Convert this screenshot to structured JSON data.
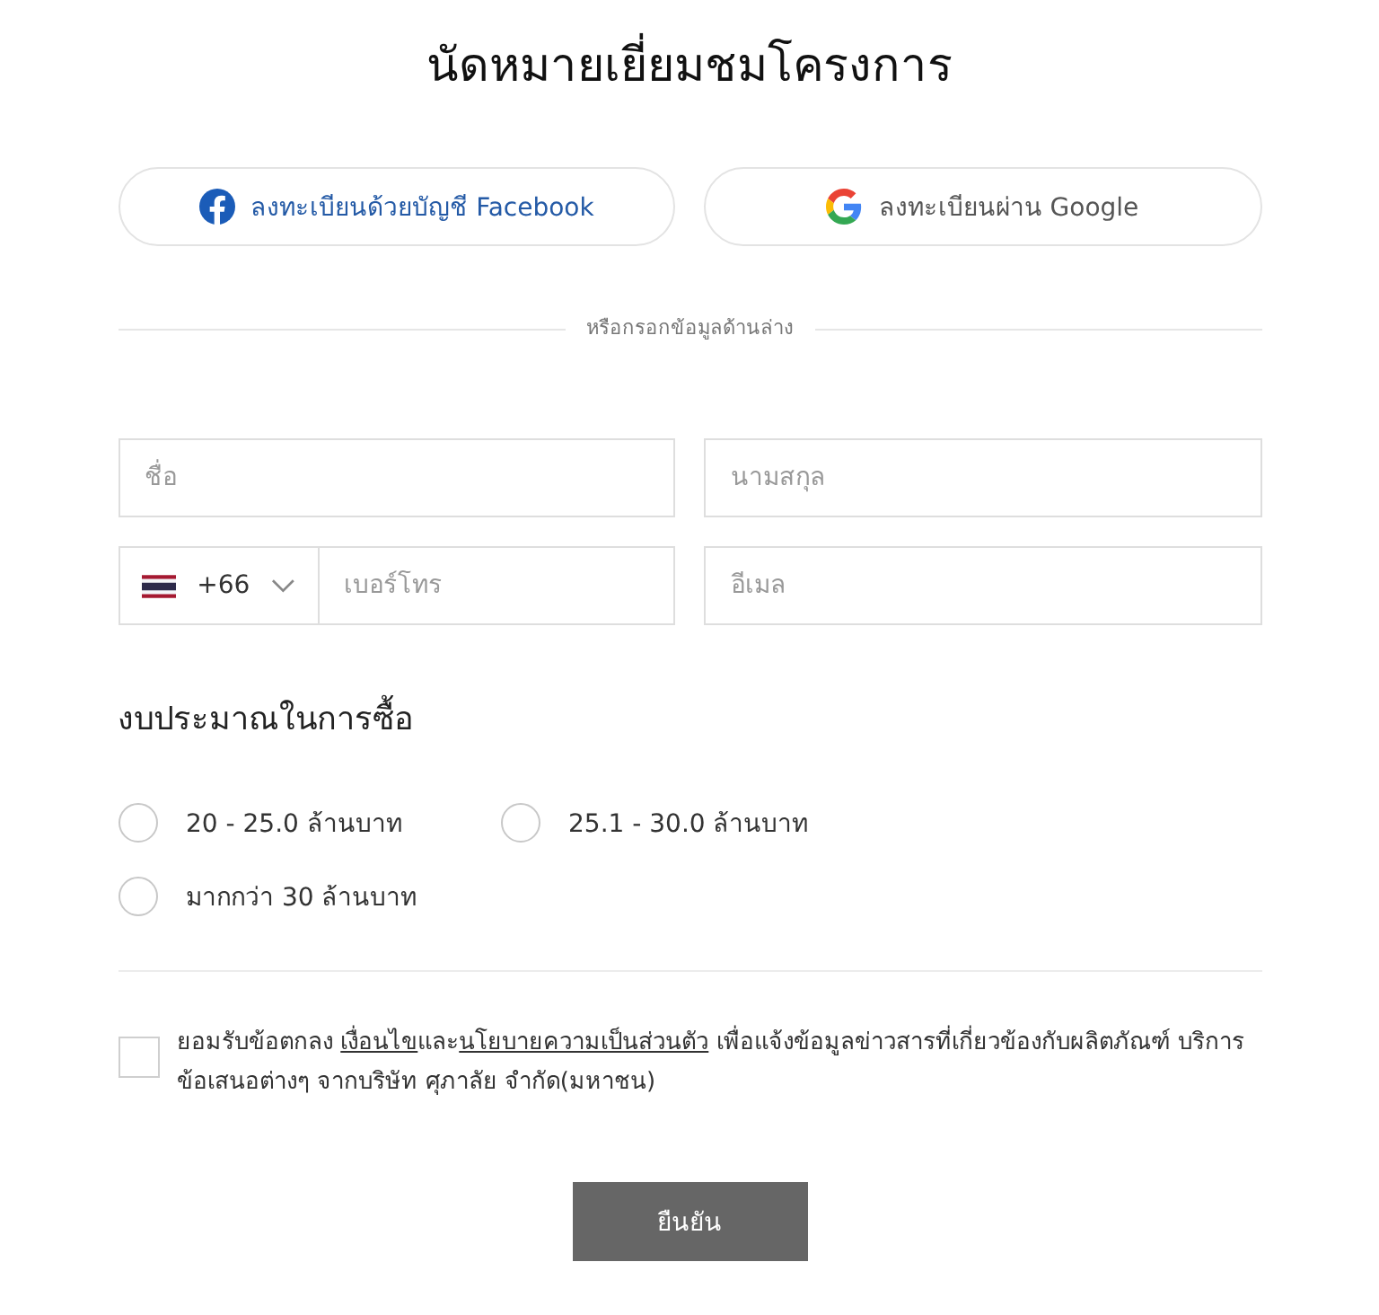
{
  "title": "นัดหมายเยี่ยมชมโครงการ",
  "social_buttons": [
    {
      "kind": "facebook",
      "label": "ลงทะเบียนด้วยบัญชี Facebook"
    },
    {
      "kind": "google",
      "label": "ลงทะเบียนผ่าน Google"
    }
  ],
  "divider_text": "หรือกรอกข้อมูลด้านล่าง",
  "fields": [
    {
      "kind": "text",
      "placeholder": "ชื่อ"
    },
    {
      "kind": "text",
      "placeholder": "นามสกุล"
    },
    {
      "kind": "phone",
      "country_code": "+66",
      "placeholder": "เบอร์โทร"
    },
    {
      "kind": "text",
      "placeholder": "อีเมล"
    }
  ],
  "budget": {
    "heading": "งบประมาณในการซื้อ",
    "options": [
      {
        "label": "20 - 25.0 ล้านบาท",
        "selected": false
      },
      {
        "label": "25.1 - 30.0 ล้านบาท",
        "selected": false
      },
      {
        "label": "มากกว่า 30 ล้านบาท",
        "selected": false
      }
    ]
  },
  "consent": {
    "checked": false,
    "parts": [
      {
        "kind": "text",
        "text": "ยอมรับข้อตกลง "
      },
      {
        "kind": "link",
        "text": "เงื่อนไข"
      },
      {
        "kind": "text",
        "text": "และ"
      },
      {
        "kind": "link",
        "text": "นโยบายความเป็นส่วนตัว"
      },
      {
        "kind": "text",
        "text": " เพื่อแจ้งข้อมูลข่าวสารที่เกี่ยวข้องกับผลิตภัณฑ์ บริการ ข้อเสนอต่างๆ จากบริษัท ศุภาลัย จำกัด(มหาชน)"
      }
    ]
  },
  "submit": "ยืนยัน"
}
